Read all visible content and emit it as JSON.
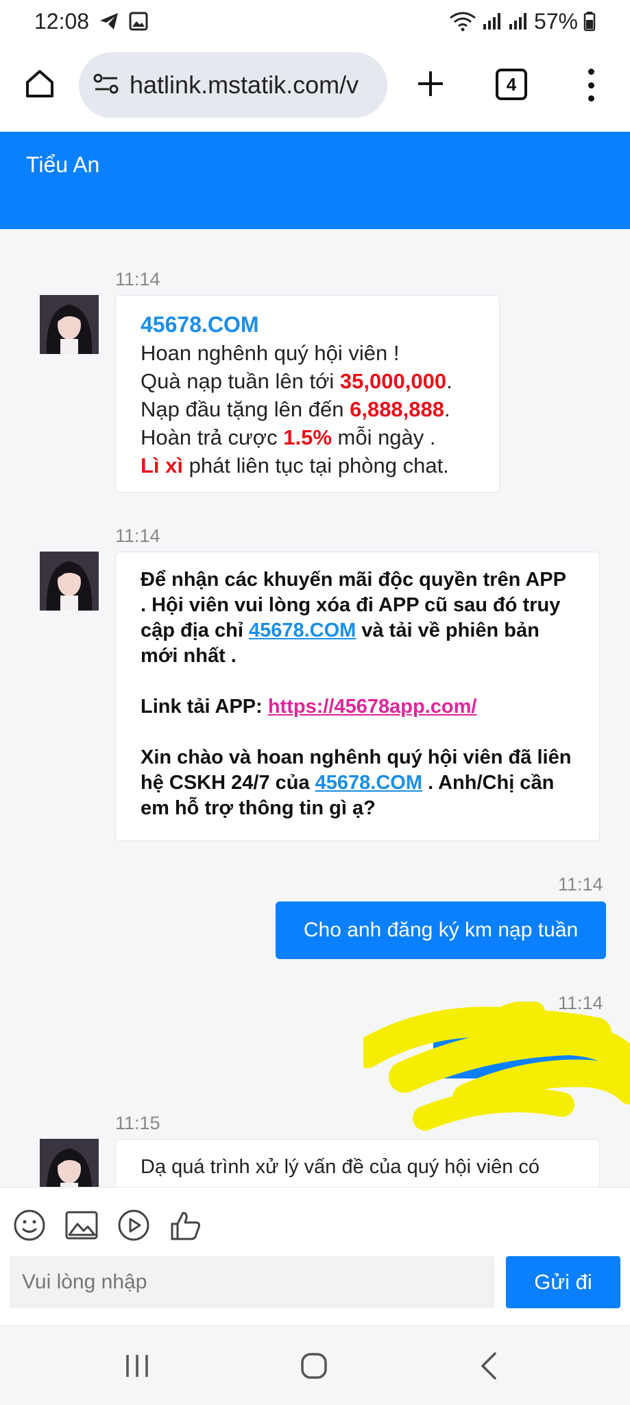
{
  "status_bar": {
    "time": "12:08",
    "battery": "57%"
  },
  "browser": {
    "url": "hatlink.mstatik.com/v",
    "tab_count": "4"
  },
  "chat": {
    "title": "Tiểu An",
    "messages": [
      {
        "time": "11:14",
        "brand": "45678.COM",
        "line1": "Hoan nghênh quý hội viên !",
        "line2_pre": "Quà nạp tuần lên tới ",
        "line2_val": "35,000,000",
        "line2_post": ".",
        "line3_pre": "Nạp đầu tặng lên đến ",
        "line3_val": "6,888,888",
        "line3_post": ".",
        "line4_pre": "Hoàn trả cược ",
        "line4_val": "1.5%",
        "line4_post": " mỗi ngày .",
        "line5_red": "Lì xì",
        "line5_post": " phát liên tục tại phòng chat."
      },
      {
        "time": "11:14",
        "p1_a": "Để nhận các khuyến mãi độc quyền trên APP . Hội viên vui lòng xóa đi APP cũ sau đó truy cập địa chỉ ",
        "p1_link": "45678.COM",
        "p1_b": " và tải về phiên bản mới nhất .",
        "p2_label": "Link tải APP: ",
        "p2_link": "https://45678app.com/",
        "p3_a": "Xin chào và hoan nghênh quý hội viên đã liên hệ CSKH 24/7 của ",
        "p3_link": "45678.COM",
        "p3_b": " . Anh/Chị cần em hỗ trợ thông tin gì ạ?"
      },
      {
        "time": "11:14",
        "text": "Cho anh đăng ký km nạp tuần"
      },
      {
        "time": "11:14"
      },
      {
        "time": "11:15",
        "text": "Dạ quá trình xử lý vấn đề của quý hội viên có"
      }
    ]
  },
  "input": {
    "placeholder": "Vui lòng nhập",
    "send_label": "Gửi đi"
  },
  "colors": {
    "accent": "#0a80ff",
    "brand_link": "#1a8ee8",
    "promo_red": "#e8111a",
    "link_pink": "#e0259a",
    "scribble": "#f5ee00"
  }
}
